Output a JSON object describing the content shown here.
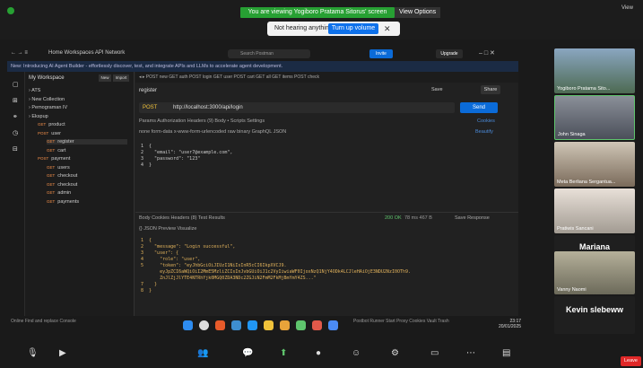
{
  "zoom": {
    "share_banner": "You are viewing Yogiboro Pratama Sitorus' screen",
    "view_options": "View Options",
    "not_hearing": "Not hearing anything?",
    "turn_up": "Turn up volume",
    "view_label": "View",
    "leave": "Leave"
  },
  "postman": {
    "title": "Home  Workspaces  API Network",
    "search_placeholder": "Search Postman",
    "invite": "Invite",
    "upgrade": "Upgrade",
    "banner": "New: Introducing AI Agent Builder - effortlessly discover, test, and integrate APIs and LLMs to accelerate agent development.",
    "workspace": "My Workspace",
    "new_btn": "New",
    "import_btn": "Import",
    "tree": [
      {
        "method": "",
        "label": "ATS",
        "level": 1
      },
      {
        "method": "",
        "label": "New Collection",
        "level": 1
      },
      {
        "method": "",
        "label": "Pemograman IV",
        "level": 1
      },
      {
        "method": "",
        "label": "Ekspup",
        "level": 1
      },
      {
        "method": "GET",
        "label": "product",
        "level": 2
      },
      {
        "method": "POST",
        "label": "user",
        "level": 2
      },
      {
        "method": "GET",
        "label": "register",
        "level": 3
      },
      {
        "method": "GET",
        "label": "cart",
        "level": 3
      },
      {
        "method": "POST",
        "label": "payment",
        "level": 2
      },
      {
        "method": "GET",
        "label": "users",
        "level": 3
      },
      {
        "method": "GET",
        "label": "checkout",
        "level": 3
      },
      {
        "method": "GET",
        "label": "checkout",
        "level": 3
      },
      {
        "method": "GET",
        "label": "admin",
        "level": 3
      },
      {
        "method": "GET",
        "label": "payments",
        "level": 3
      }
    ],
    "request_name": "register",
    "save": "Save",
    "share": "Share",
    "method": "POST",
    "url": "http://localhost:3000/api/login",
    "send": "Send",
    "req_tabs": "Params   Authorization   Headers (9)   Body •   Scripts   Settings",
    "body_opts": "none   form-data   x-www-form-urlencoded   raw   binary   GraphQL   JSON",
    "cookies": "Cookies",
    "beautify": "Beautify",
    "request_body": "1  {\n2    \"email\": \"user7@example.com\",\n3    \"password\": \"123\"\n4  }",
    "resp_tabs": "Body   Cookies   Headers (8)   Test Results",
    "status": "200 OK",
    "resp_meta": "78 ms   467 B",
    "save_response": "Save Response",
    "resp_tools": "{} JSON   Preview   Visualize",
    "response_body": "1  {\n2    \"message\": \"Login successful\",\n3    \"user\": {\n4      \"role\": \"user\",\n5      \"token\": \"eyJhbGciOiJIUzI1NiIsInR5cCI6IkpXVCJ9.\n       eyJpZCI6aWQiOiI2MmE5MzliZCIsInJvbGUiOiJ1c2VyIiwiaWF0IjoxNzQ1NjY4ODk4LCJleHAiOjE3NDU2NzI0OTh9.\n       ZnJlZjJlYTE4NTRhYjk0MGQ0ZDA3NDc2ZGJiN2FmM2FkMjBmYmY4ZS...\"\n7    }\n8  }",
    "status_bar": "Online   Find and replace   Console",
    "status_right": "Postbot   Runner   Start Proxy   Cookies   Vault   Trash"
  },
  "clock": {
    "time": "23:17",
    "date": "20/01/2025"
  },
  "participants": [
    {
      "name": "Yogiboro Pratama Sito...",
      "type": "video"
    },
    {
      "name": "John Sinaga",
      "type": "video"
    },
    {
      "name": "Meta Berliana Sergantua...",
      "type": "video"
    },
    {
      "name": "Pratiwis Sancani",
      "type": "video"
    },
    {
      "name": "Mariana",
      "type": "text"
    },
    {
      "name": "Vanny Naomi",
      "type": "video"
    },
    {
      "name": "Kevin slebeww",
      "type": "text"
    }
  ]
}
